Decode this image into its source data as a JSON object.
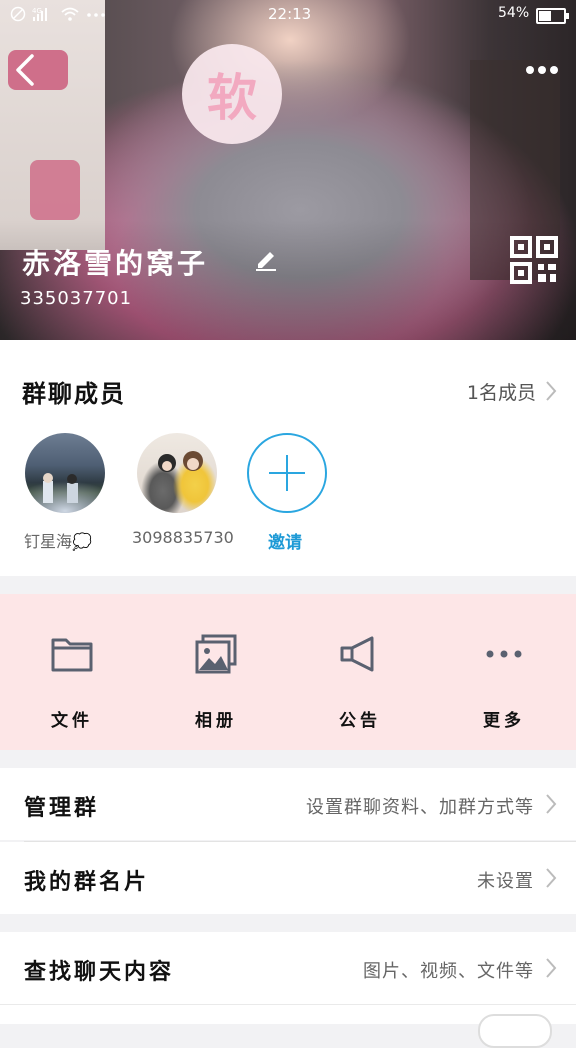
{
  "status_bar": {
    "time": "22:13",
    "battery": "54%",
    "signal_text": "4G"
  },
  "header": {
    "sticker_char": "软",
    "group_name": "赤洛雪的窝子",
    "group_id": "335037701"
  },
  "members": {
    "title": "群聊成员",
    "count_label": "1名成员",
    "list": [
      {
        "name": "钉星海💭"
      },
      {
        "name": "3098835730"
      }
    ],
    "invite_label": "邀请"
  },
  "actions": [
    {
      "label": "文件",
      "icon": "folder-icon"
    },
    {
      "label": "相册",
      "icon": "album-icon"
    },
    {
      "label": "公告",
      "icon": "megaphone-icon"
    },
    {
      "label": "更多",
      "icon": "more-dots-icon"
    }
  ],
  "rows": {
    "manage": {
      "label": "管理群",
      "value": "设置群聊资料、加群方式等"
    },
    "card": {
      "label": "我的群名片",
      "value": "未设置"
    },
    "search": {
      "label": "查找聊天内容",
      "value": "图片、视频、文件等"
    }
  },
  "colors": {
    "accent": "#2aa6e0",
    "action_bg": "#fde6e7",
    "icon_gray": "#5a6170"
  }
}
